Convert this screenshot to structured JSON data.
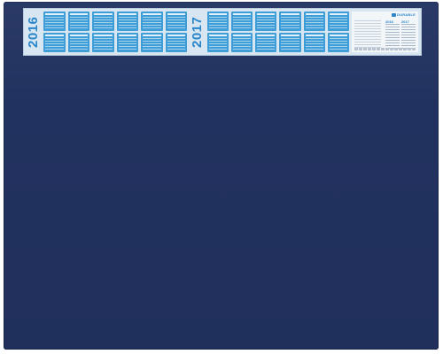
{
  "calendar": {
    "year_1": "2016",
    "year_2": "2017"
  },
  "brand": {
    "name": "DURABLE"
  },
  "colors": {
    "mat": "#223260",
    "strip": "#d8e6f2",
    "month_block": "#3f9ed8",
    "accent_text": "#2a86c9"
  }
}
